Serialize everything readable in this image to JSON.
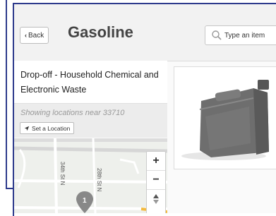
{
  "header": {
    "back_label": "Back",
    "title": "Gasoline",
    "search_placeholder": "Type an item"
  },
  "facility": {
    "name": "Drop-off - Household Chemical and Electronic Waste"
  },
  "location": {
    "showing_text": "Showing locations near 33710",
    "set_location_label": "Set a Location"
  },
  "map": {
    "streets": [
      "34th St N",
      "28th St N"
    ],
    "zoom_in_label": "+",
    "zoom_out_label": "−",
    "marker_label": "1"
  },
  "colors": {
    "frame": "#2d3a8c",
    "header_bg": "#f2f2f2",
    "marker": "#888888",
    "jerrycan": "#6e6e6e"
  }
}
